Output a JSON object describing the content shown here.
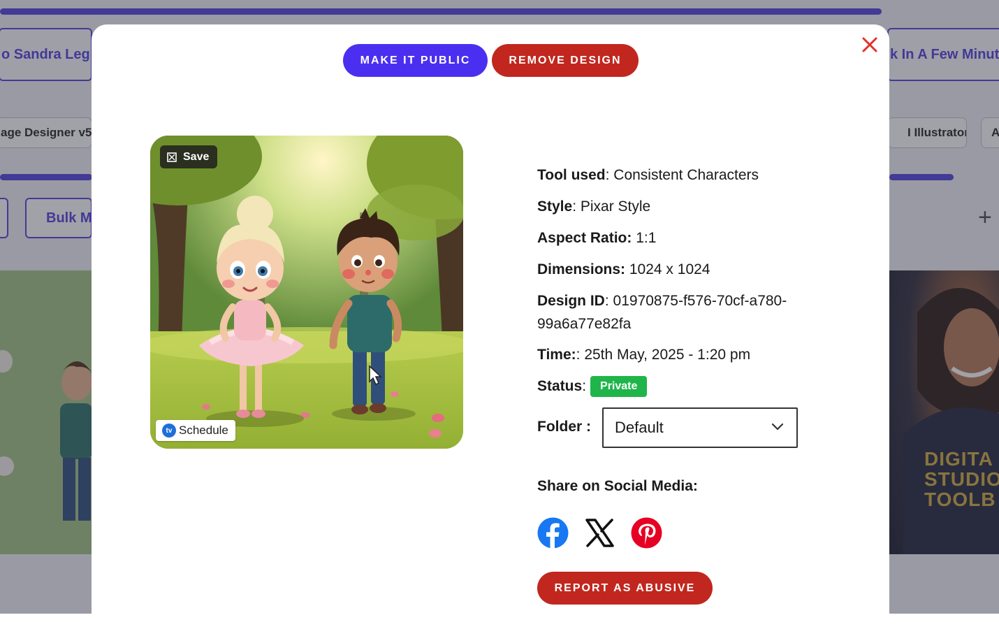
{
  "background": {
    "tab_left": "o Sandra Leg",
    "tab_right": "k In A Few Minut",
    "pill_left": "age Designer v5",
    "pill_right": "I Illustrator",
    "pill_far_right": "A",
    "button_left": "Bulk M",
    "plus_symbol": "+",
    "hoodie_text": [
      "DIGITA",
      "STUDIO",
      "TOOLB"
    ]
  },
  "modal": {
    "actions": {
      "make_public": "MAKE IT PUBLIC",
      "remove_design": "REMOVE DESIGN"
    },
    "close_icon": "close-icon",
    "image": {
      "save_label": "Save",
      "schedule_label": "Schedule",
      "schedule_logo": "tv"
    },
    "details": {
      "tool_label": "Tool used",
      "tool_value": "Consistent Characters",
      "style_label": "Style",
      "style_value": "Pixar Style",
      "aspect_label": "Aspect Ratio:",
      "aspect_value": "1:1",
      "dimensions_label": "Dimensions:",
      "dimensions_value": "1024 x 1024",
      "design_id_label": "Design ID",
      "design_id_value": "01970875-f576-70cf-a780-99a6a77e82fa",
      "time_label": "Time:",
      "time_value": "25th May, 2025 - 1:20 pm",
      "status_label": "Status",
      "status_value": "Private",
      "folder_label": "Folder :",
      "folder_value": "Default"
    },
    "share": {
      "title": "Share on Social Media:",
      "networks": [
        "facebook-icon",
        "x-icon",
        "pinterest-icon"
      ]
    },
    "report_label": "REPORT AS ABUSIVE"
  },
  "colors": {
    "primary": "#4b2ff0",
    "danger": "#c1271f",
    "status_private": "#1fb54a",
    "facebook": "#1877f2",
    "pinterest": "#e60023"
  }
}
